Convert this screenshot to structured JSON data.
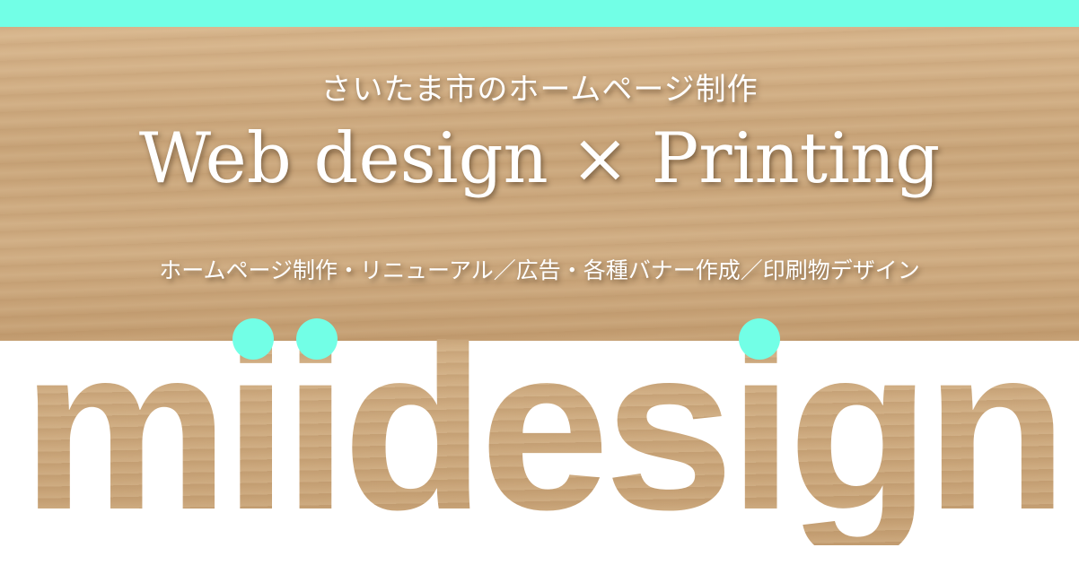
{
  "banner": {
    "subtitle_top": "さいたま市のホームページ制作",
    "headline": "Web design × Printing",
    "services": "ホームページ制作・リニューアル／広告・各種バナー作成／印刷物デザイン",
    "logo": "miidesign"
  },
  "colors": {
    "accent": "#72ffe6",
    "wood": "#c9a57a",
    "text": "#ffffff"
  }
}
